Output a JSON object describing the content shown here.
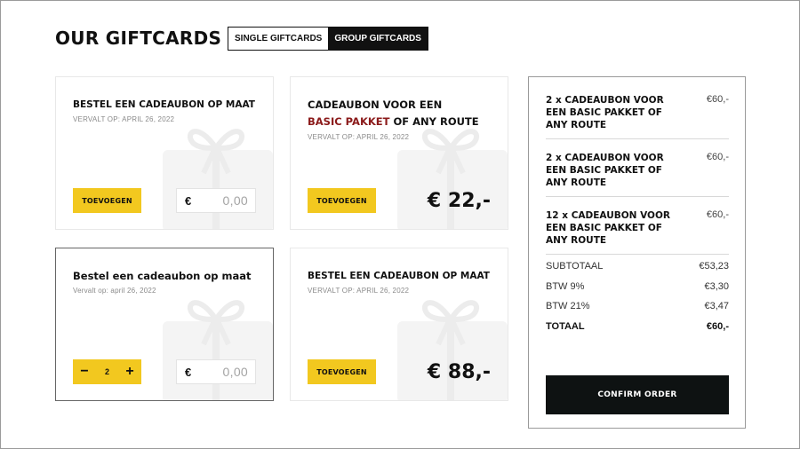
{
  "header": {
    "title": "OUR GIFTCARDS",
    "tabs": [
      {
        "label": "SINGLE GIFTCARDS",
        "active": false
      },
      {
        "label": "GROUP GIFTCARDS",
        "active": true
      }
    ]
  },
  "cards": [
    {
      "title": "BESTEL EEN CADEAUBON OP MAAT",
      "expiry": "VERVALT OP: APRIL 26, 2022",
      "add_label": "TOEVOEGEN",
      "currency": "€",
      "amount": "0,00"
    },
    {
      "title_line1": "CADEAUBON VOOR EEN",
      "title_highlight": "BASIC PAKKET",
      "title_rest": " OF ANY ROUTE",
      "expiry": "VERVALT OP: APRIL 26, 2022",
      "add_label": "TOEVOEGEN",
      "price": "€ 22,-"
    },
    {
      "title": "Bestel een cadeaubon op maat",
      "expiry": "Vervalt op: april 26, 2022",
      "stepper": {
        "minus": "−",
        "quantity": "2",
        "plus": "+"
      },
      "currency": "€",
      "amount": "0,00"
    },
    {
      "title": "BESTEL EEN CADEAUBON OP MAAT",
      "expiry": "VERVALT OP: APRIL 26, 2022",
      "add_label": "TOEVOEGEN",
      "price": "€ 88,-"
    }
  ],
  "summary": {
    "items": [
      {
        "description": "2 x CADEAUBON VOOR EEN BASIC PAKKET OF ANY ROUTE",
        "amount": "€60,-"
      },
      {
        "description": "2 x CADEAUBON VOOR EEN BASIC PAKKET OF ANY ROUTE",
        "amount": "€60,-"
      },
      {
        "description": "12 x CADEAUBON VOOR EEN BASIC PAKKET OF ANY ROUTE",
        "amount": "€60,-"
      }
    ],
    "subtotal_label": "SUBTOTAAL",
    "subtotal": "€53,23",
    "btw9_label": "BTW 9%",
    "btw9": "€3,30",
    "btw21_label": "BTW 21%",
    "btw21": "€3,47",
    "total_label": "TOTAAL",
    "total": "€60,-",
    "confirm_label": "CONFIRM ORDER"
  },
  "colors": {
    "accent_yellow": "#f2c81f",
    "highlight_red": "#8b1a1a",
    "dark": "#0e1212"
  }
}
